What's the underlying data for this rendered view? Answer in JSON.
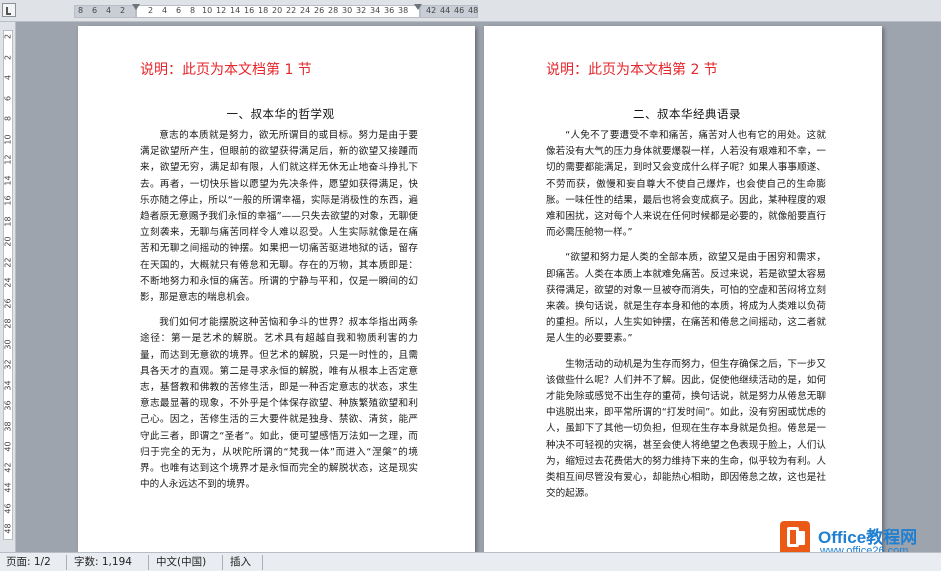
{
  "ruler": {
    "top_numbers": [
      "8",
      "6",
      "4",
      "2",
      "2",
      "4",
      "6",
      "8",
      "10",
      "12",
      "14",
      "16",
      "18",
      "20",
      "22",
      "24",
      "26",
      "28",
      "30",
      "32",
      "34",
      "36",
      "38",
      "42",
      "44",
      "46",
      "48"
    ],
    "left_numbers": [
      "2",
      "2",
      "4",
      "6",
      "8",
      "10",
      "12",
      "14",
      "16",
      "18",
      "20",
      "22",
      "24",
      "26",
      "28",
      "30",
      "32",
      "34",
      "36",
      "38",
      "40",
      "42",
      "44",
      "46",
      "48"
    ]
  },
  "page1": {
    "note": "说明：此页为本文档第 1 节",
    "heading": "一、叔本华的哲学观",
    "paragraphs": [
      "意志的本质就是努力，欲无所谓目的或目标。努力是由于要满足欲望所产生，但眼前的欲望获得满足后，新的欲望又接踵而来，欲望无穷，满足却有限，人们就这样无休无止地奋斗挣扎下去。再者，一切快乐皆以愿望为先决条件，愿望如获得满足，快乐亦随之停止，所以“一般的所谓幸福，实际是消极性的东西，遍趋者原无意赐予我们永恒的幸福”——只失去欲望的对象，无聊便立刻袭来，无聊与痛苦同样令人难以忍受。人生实际就像是在痛苦和无聊之间摇动的钟摆。如果把一切痛苦驱进地狱的话，留存在天国的，大概就只有倦怠和无聊。存在的万物，其本质即是：不断地努力和永恒的痛苦。所谓的宁静与平和，仅是一瞬间的幻影，那是意志的喘息机会。",
      "我们如何才能摆脱这种苦恼和争斗的世界？叔本华指出两条途径：第一是艺术的解脱。艺术具有超越自我和物质利害的力量，而达到无意欲的境界。但艺术的解脱，只是一时性的，且需具各天才的直观。第二是寻求永恒的解脱，唯有从根本上否定意志，基督教和佛教的苦修生活，即是一种否定意志的状态，求生意志最显著的现象，不外乎是个体保存欲望、种族繁殖欲望和利己心。因之，苦修生活的三大要件就是独身、禁欲、清贫，能严守此三者，即谓之“圣者”。如此，便可望感悟万法如一之理，而归于完全的无为，从吠陀所谓的“梵我一体”而进入“涅槃”的境界。也唯有达到这个境界才是永恒而完全的解脱状态，这是现实中的人永远达不到的境界。"
    ]
  },
  "page2": {
    "note": "说明：此页为本文档第 2 节",
    "heading": "二、叔本华经典语录",
    "paragraphs": [
      "“人免不了要遭受不幸和痛苦，痛苦对人也有它的用处。这就像若没有大气的压力身体就要爆裂一样，人若没有艰难和不幸，一切的需要都能满足，到时又会变成什么样子呢？如果人事事顺遂、不劳而获，傲慢和妄自尊大不使自己爆炸，也会使自己的生命膨胀。一味任性的结果，最后也将会变成疯子。因此，某种程度的艰难和困扰，这对每个人来说在任何时候都是必要的，就像船要直行而必需压舱物一样。”",
      "“欲望和努力是人类的全部本质，欲望又是由于困穷和需求，即痛苦。人类在本质上本就难免痛苦。反过来说，若是欲望太容易获得满足，欲望的对象一旦被夺而消失，可怕的空虚和苦闷将立刻来袭。换句话说，就是生存本身和他的本质，将成为人类难以负荷的重担。所以，人生实如钟摆，在痛苦和倦怠之间摇动，这二者就是人生的必要要素。”",
      "生物活动的动机是为生存而努力，但生存确保之后，下一步又该做些什么呢？人们并不了解。因此，促使他继续活动的是，如何才能免除或感觉不出生存的重荷，换句话说，就是努力从倦怠无聊中逃脱出来，即平常所谓的“打发时间”。如此，没有穷困或忧虑的人，虽卸下了其他一切负担，但现在生存本身就是负担。倦怠是一种决不可轻视的灾祸，甚至会使人将绝望之色表现于脸上，人们认为，缩短过去花费偌大的努力维持下来的生命，似乎较为有利。人类相互间尽管没有爱心，却能热心相助，即因倦怠之故，这也是社交的起源。"
    ]
  },
  "status": {
    "page": "页面: 1/2",
    "words": "字数: 1,194",
    "language": "中文(中国)",
    "mode": "插入"
  },
  "watermark": {
    "brand": "Office教程网",
    "url": "www.office26.com"
  },
  "colors": {
    "note_red": "#e4262b",
    "watermark_blue": "#1f7fd1",
    "watermark_orange": "#ea5a16"
  }
}
